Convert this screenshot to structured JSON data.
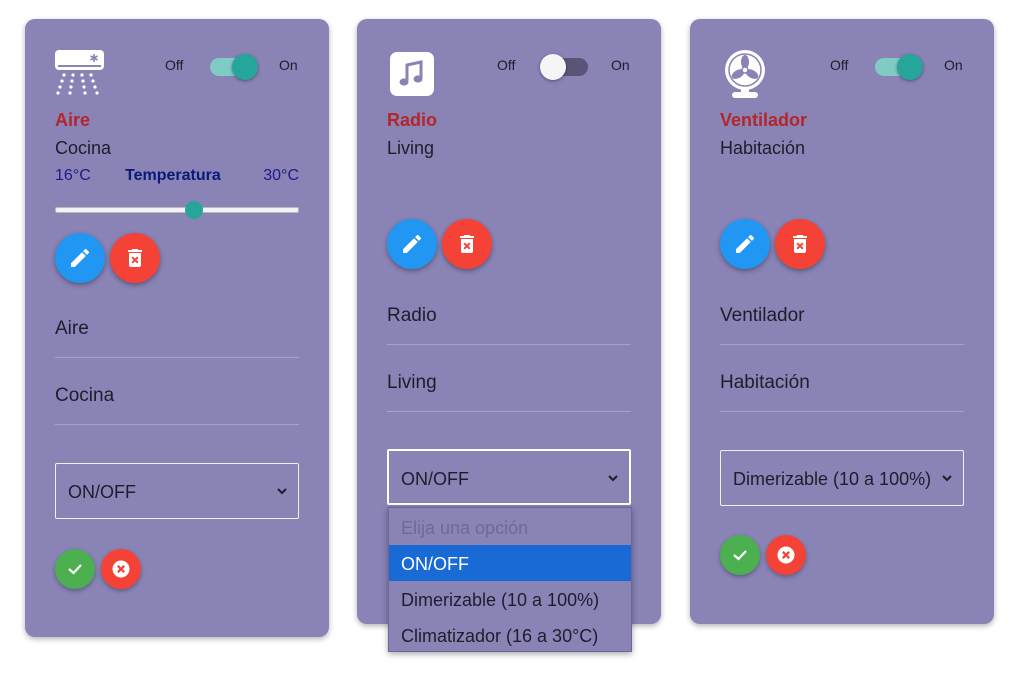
{
  "toggle": {
    "off_label": "Off",
    "on_label": "On"
  },
  "cards": [
    {
      "device_name": "Aire",
      "room": "Cocina",
      "icon": "air-conditioner-icon",
      "power": "on",
      "temperature": {
        "min": "16°C",
        "label": "Temperatura",
        "max": "30°C",
        "level": 0.57
      },
      "form": {
        "name_value": "Aire",
        "room_value": "Cocina",
        "type_value": "ON/OFF"
      }
    },
    {
      "device_name": "Radio",
      "room": "Living",
      "icon": "music-note-icon",
      "power": "off",
      "form": {
        "name_value": "Radio",
        "room_value": "Living",
        "type_value": "ON/OFF"
      }
    },
    {
      "device_name": "Ventilador",
      "room": "Habitación",
      "icon": "fan-icon",
      "power": "on",
      "form": {
        "name_value": "Ventilador",
        "room_value": "Habitación",
        "type_value": "Dimerizable (10 a 100%)"
      }
    }
  ],
  "dropdown": {
    "options": [
      {
        "label": "Elija una opción",
        "state": "disabled"
      },
      {
        "label": "ON/OFF",
        "state": "selected"
      },
      {
        "label": "Dimerizable (10 a 100%)",
        "state": "normal"
      },
      {
        "label": "Climatizador (16 a 30°C)",
        "state": "normal"
      }
    ]
  },
  "colors": {
    "card_bg": "#8983b6",
    "device_name": "#b3262b",
    "toggle_on": "#26a69a",
    "edit_button": "#2196f3",
    "delete_button": "#f44336",
    "confirm_button": "#4caf50",
    "dropdown_selected": "#1a6ad6"
  }
}
